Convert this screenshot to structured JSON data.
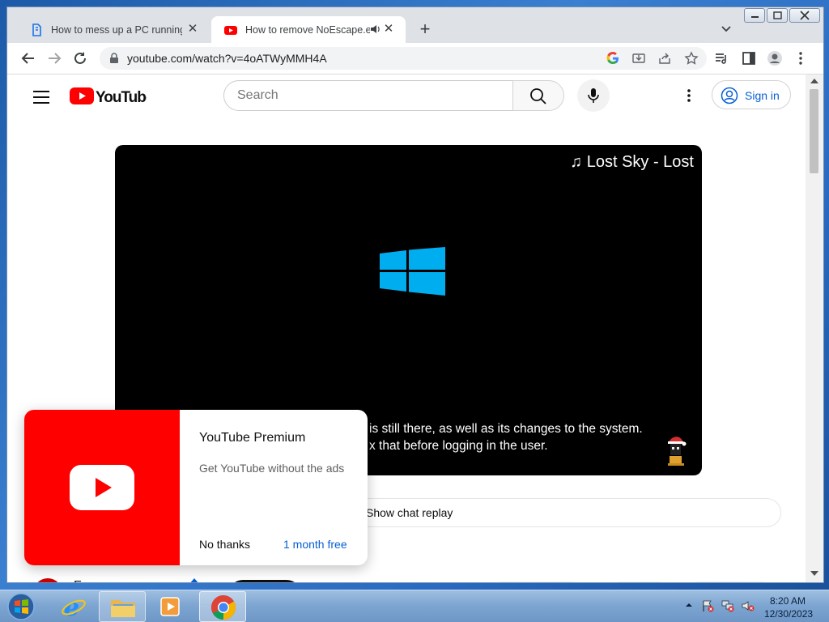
{
  "browser": {
    "tabs": [
      {
        "title": "How to mess up a PC running Wi",
        "active": false
      },
      {
        "title": "How to remove NoEscape.ex",
        "active": true
      }
    ],
    "url": "youtube.com/watch?v=4oATWyMMH4A"
  },
  "youtube": {
    "search_placeholder": "Search",
    "sign_in_label": "Sign in",
    "video": {
      "overlay_title": "♫ Lost Sky - Lost",
      "subtitle_line1": "is still there, as well as its changes to the system.",
      "subtitle_line2": "x that before logging in the user."
    },
    "chat_replay_label": "Show chat replay",
    "channel_name_partial": "E"
  },
  "premium_popup": {
    "title": "YouTube Premium",
    "description": "Get YouTube without the ads",
    "dismiss_label": "No thanks",
    "accept_label": "1 month free"
  },
  "taskbar": {
    "clock_time": "8:20 AM",
    "clock_date": "12/30/2023"
  },
  "colors": {
    "youtube_red": "#ff0000",
    "link_blue": "#065fd4",
    "windows_logo_blue": "#00adef"
  }
}
